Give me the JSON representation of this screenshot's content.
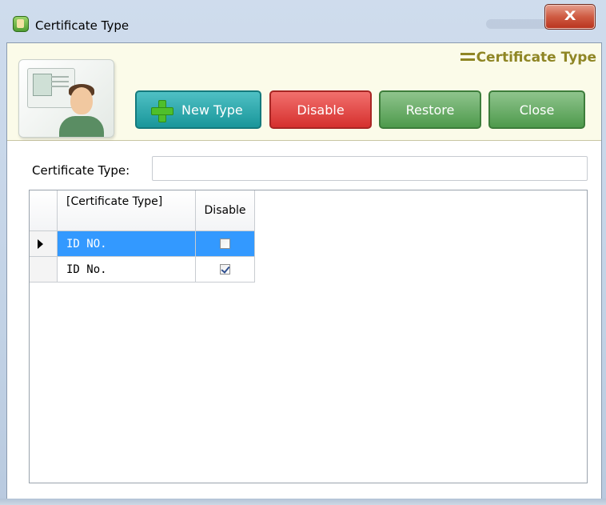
{
  "window": {
    "title": "Certificate Type",
    "close_glyph": "X"
  },
  "header": {
    "title": "Certificate Type"
  },
  "toolbar": {
    "new_type_label": "New Type",
    "disable_label": "Disable",
    "restore_label": "Restore",
    "close_label": "Close"
  },
  "form": {
    "certificate_type_label": "Certificate Type:",
    "certificate_type_value": "",
    "certificate_type_placeholder": ""
  },
  "grid": {
    "columns": [
      "[Certificate Type]",
      "Disable"
    ],
    "rows": [
      {
        "certificate_type": "ID NO.",
        "disabled": false,
        "selected": true
      },
      {
        "certificate_type": "ID No.",
        "disabled": true,
        "selected": false
      }
    ]
  },
  "colors": {
    "new_type_button": "#19969a",
    "disable_button": "#d5302e",
    "restore_button": "#4e9a4c",
    "close_button": "#4e9a4c",
    "selection": "#3399ff",
    "header_title": "#8f8625",
    "header_panel": "#fbfbe9"
  },
  "icons": {
    "app": "certificate-app-icon",
    "header_image": "id-card-person-icon",
    "new_type": "green-plus-icon",
    "row_indicator": "row-pointer-icon"
  }
}
